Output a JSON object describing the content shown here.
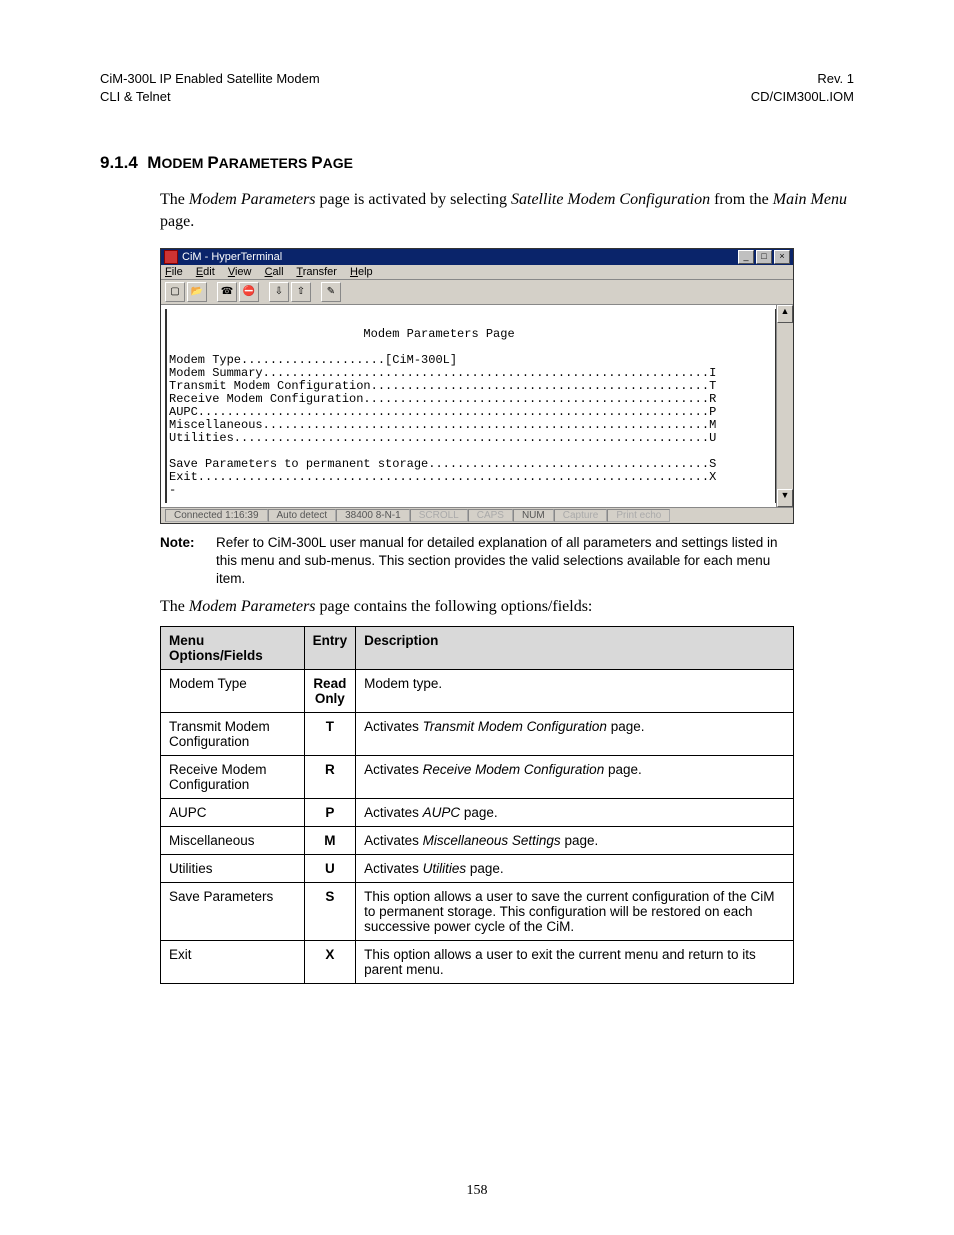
{
  "header": {
    "left_line1": "CiM-300L IP Enabled Satellite Modem",
    "left_line2": "CLI & Telnet",
    "right_line1": "Rev. 1",
    "right_line2": "CD/CIM300L.IOM"
  },
  "section": {
    "number": "9.1.4",
    "title_caps": "M",
    "title_rest": "ODEM ",
    "title_caps2": "P",
    "title_rest2": "ARAMETERS ",
    "title_caps3": "P",
    "title_rest3": "AGE"
  },
  "intro": {
    "pre": "The ",
    "ital1": "Modem Parameters",
    "mid1": " page is activated by selecting ",
    "ital2": "Satellite Modem Configuration",
    "mid2": " from the ",
    "ital3": "Main Menu",
    "post": " page."
  },
  "hyperterminal": {
    "title": "CiM - HyperTerminal",
    "menu": {
      "file": "File",
      "edit": "Edit",
      "view": "View",
      "call": "Call",
      "transfer": "Transfer",
      "help": "Help"
    },
    "term_title": "Modem Parameters Page",
    "lines": [
      "Modem Type....................[CiM-300L]",
      "Modem Summary..............................................................I",
      "Transmit Modem Configuration...............................................T",
      "Receive Modem Configuration................................................R",
      "AUPC.......................................................................P",
      "Miscellaneous..............................................................M",
      "Utilities..................................................................U",
      "",
      "Save Parameters to permanent storage.......................................S",
      "Exit.......................................................................X",
      "-"
    ],
    "status": {
      "connected": "Connected 1:16:39",
      "detect": "Auto detect",
      "baud": "38400 8-N-1",
      "scroll": "SCROLL",
      "caps": "CAPS",
      "num": "NUM",
      "capture": "Capture",
      "printecho": "Print echo"
    }
  },
  "note": {
    "label": "Note:",
    "text": "Refer to CiM-300L user manual for detailed explanation of all parameters and settings listed in this menu and sub-menus. This section provides the valid selections available for each menu item."
  },
  "body_line": {
    "pre": "The ",
    "ital": "Modem Parameters",
    "post": " page contains the following options/fields:"
  },
  "table": {
    "headers": {
      "c1": "Menu Options/Fields",
      "c2": "Entry",
      "c3": "Description"
    },
    "rows": [
      {
        "field": "Modem Type",
        "entry": "Read\nOnly",
        "desc_pre": "Modem type.",
        "desc_ital": "",
        "desc_post": ""
      },
      {
        "field": "Transmit Modem Configuration",
        "entry": "T",
        "desc_pre": "Activates ",
        "desc_ital": "Transmit Modem Configuration",
        "desc_post": " page."
      },
      {
        "field": "Receive Modem Configuration",
        "entry": "R",
        "desc_pre": "Activates ",
        "desc_ital": "Receive Modem Configuration",
        "desc_post": " page."
      },
      {
        "field": "AUPC",
        "entry": "P",
        "desc_pre": "Activates ",
        "desc_ital": "AUPC",
        "desc_post": " page."
      },
      {
        "field": "Miscellaneous",
        "entry": "M",
        "desc_pre": "Activates ",
        "desc_ital": "Miscellaneous Settings",
        "desc_post": " page."
      },
      {
        "field": "Utilities",
        "entry": "U",
        "desc_pre": "Activates ",
        "desc_ital": "Utilities",
        "desc_post": " page."
      },
      {
        "field": "Save Parameters",
        "entry": "S",
        "desc_pre": "This option allows a user to save the current configuration of the CiM to permanent storage. This configuration will be restored on each successive power cycle of the CiM.",
        "desc_ital": "",
        "desc_post": ""
      },
      {
        "field": "Exit",
        "entry": "X",
        "desc_pre": "This option allows a user to exit the current menu and return to its parent menu.",
        "desc_ital": "",
        "desc_post": ""
      }
    ]
  },
  "page_number": "158"
}
